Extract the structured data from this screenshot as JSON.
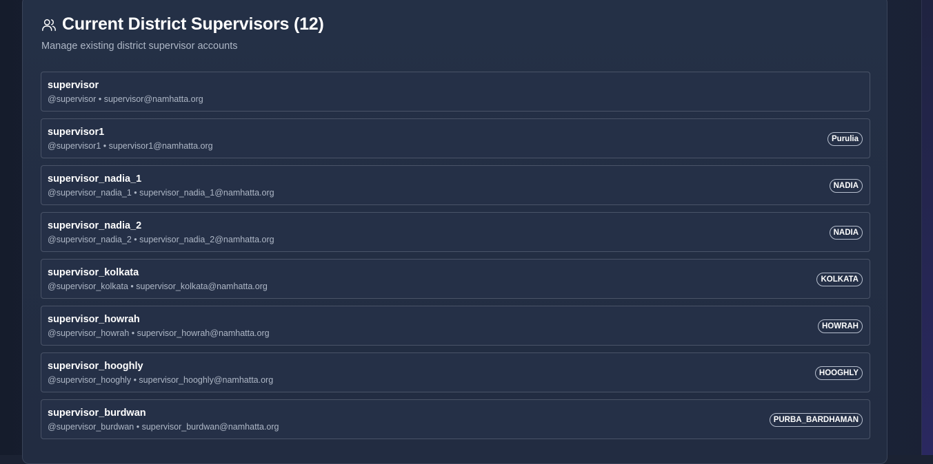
{
  "header": {
    "title": "Current District Supervisors (12)",
    "subtitle": "Manage existing district supervisor accounts"
  },
  "supervisors": [
    {
      "name": "supervisor",
      "username": "@supervisor",
      "email": "supervisor@namhatta.org",
      "district": ""
    },
    {
      "name": "supervisor1",
      "username": "@supervisor1",
      "email": "supervisor1@namhatta.org",
      "district": "Purulia"
    },
    {
      "name": "supervisor_nadia_1",
      "username": "@supervisor_nadia_1",
      "email": "supervisor_nadia_1@namhatta.org",
      "district": "NADIA"
    },
    {
      "name": "supervisor_nadia_2",
      "username": "@supervisor_nadia_2",
      "email": "supervisor_nadia_2@namhatta.org",
      "district": "NADIA"
    },
    {
      "name": "supervisor_kolkata",
      "username": "@supervisor_kolkata",
      "email": "supervisor_kolkata@namhatta.org",
      "district": "KOLKATA"
    },
    {
      "name": "supervisor_howrah",
      "username": "@supervisor_howrah",
      "email": "supervisor_howrah@namhatta.org",
      "district": "HOWRAH"
    },
    {
      "name": "supervisor_hooghly",
      "username": "@supervisor_hooghly",
      "email": "supervisor_hooghly@namhatta.org",
      "district": "HOOGHLY"
    },
    {
      "name": "supervisor_burdwan",
      "username": "@supervisor_burdwan",
      "email": "supervisor_burdwan@namhatta.org",
      "district": "PURBA_BARDHAMAN"
    }
  ],
  "separator": " • ",
  "icons": {
    "header": "users-icon"
  }
}
